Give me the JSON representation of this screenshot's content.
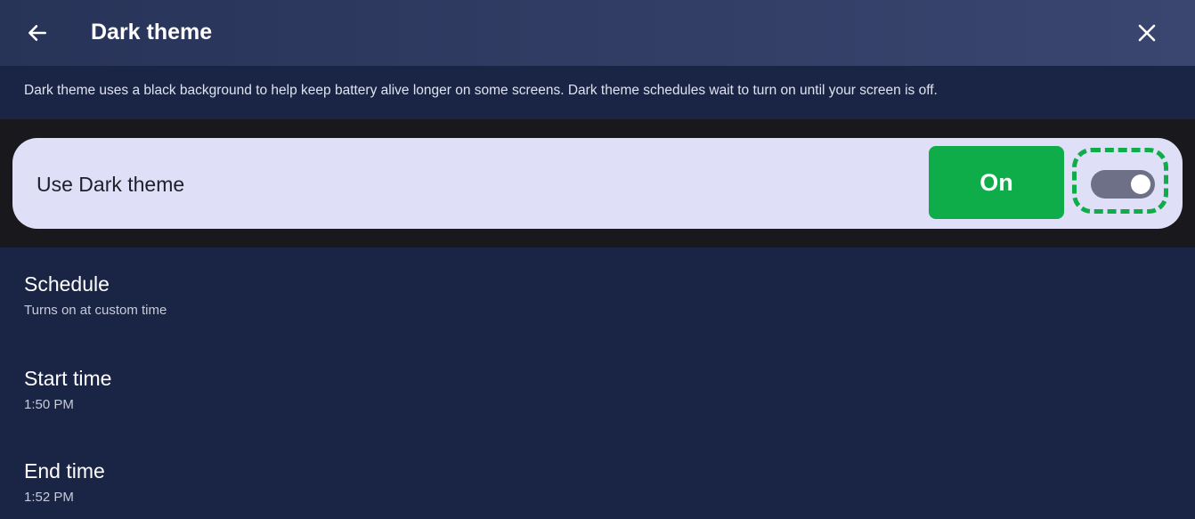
{
  "header": {
    "title": "Dark theme",
    "back_icon": "arrow-left-icon",
    "close_icon": "close-icon"
  },
  "description": "Dark theme uses a black background to help keep battery alive longer on some screens. Dark theme schedules wait to turn on until your screen is off.",
  "dark_toggle": {
    "label": "Use Dark theme",
    "state_label": "On",
    "enabled": true,
    "accent_color": "#0fac4a"
  },
  "settings": [
    {
      "title": "Schedule",
      "subtitle": "Turns on at custom time"
    },
    {
      "title": "Start time",
      "subtitle": "1:50 PM"
    },
    {
      "title": "End time",
      "subtitle": "1:52 PM"
    }
  ],
  "colors": {
    "background": "#1a2545",
    "header": "#2f3b63",
    "card": "#dfe0f8",
    "band": "#19191d"
  }
}
